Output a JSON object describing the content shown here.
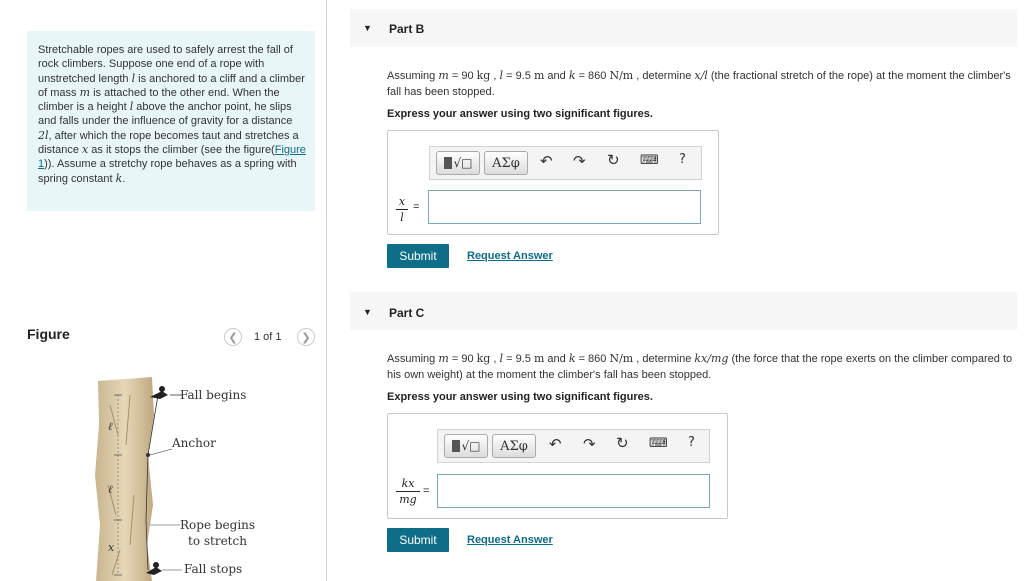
{
  "problem": {
    "text_parts": [
      "Stretchable ropes are used to safely arrest the fall of rock climbers. Suppose one end of a rope with unstretched length ",
      "l",
      " is anchored to a cliff and a climber of mass ",
      "m",
      " is attached to the other end. When the climber is a height ",
      "l",
      " above the anchor point, he slips and falls under the influence of gravity for a distance ",
      "2l",
      ", after which the rope becomes taut and stretches a distance ",
      "x",
      " as it stops the climber (see the figure(",
      "Figure 1",
      ")). Assume a stretchy rope behaves as a spring with spring constant ",
      "k",
      "."
    ]
  },
  "figure": {
    "label": "Figure",
    "pager": "1 of 1",
    "prev_icon": "chevron-left-icon",
    "next_icon": "chevron-right-icon",
    "annotations": [
      "Fall begins",
      "Anchor",
      "Rope begins",
      "to stretch",
      "Fall stops"
    ],
    "side_labels": [
      "ℓ",
      "ℓ",
      "x"
    ]
  },
  "parts": [
    {
      "title": "Part B",
      "q_parts": [
        "Assuming ",
        "m",
        " = 90 ",
        "kg",
        " , ",
        "l",
        " = 9.5 ",
        "m",
        " and ",
        "k",
        " = 860 ",
        "N/m",
        " , determine ",
        "x/l",
        " (the fractional stretch of the rope) at the moment the climber's fall has been stopped."
      ],
      "instruction": "Express your answer using two significant figures.",
      "frac_num": "x",
      "frac_den": "l",
      "equals": "=",
      "submit": "Submit",
      "request": "Request Answer"
    },
    {
      "title": "Part C",
      "q_parts": [
        "Assuming ",
        "m",
        " = 90 ",
        "kg",
        " , ",
        "l",
        " = 9.5 ",
        "m",
        " and ",
        "k",
        " = 860 ",
        "N/m",
        " , determine ",
        "kx/mg",
        " (the force that the rope exerts on the climber compared to his own weight) at the moment the climber's fall has been stopped."
      ],
      "instruction": "Express your answer using two significant figures.",
      "frac_num": "kx",
      "frac_den": "mg",
      "equals": "=",
      "submit": "Submit",
      "request": "Request Answer"
    }
  ],
  "toolbar": {
    "greek": "ΑΣφ",
    "icons": [
      "template-icon",
      "undo-icon",
      "redo-icon",
      "reset-icon",
      "keyboard-icon",
      "help-icon"
    ],
    "help": "?"
  },
  "colors": {
    "accent": "#0e6d87",
    "problem_bg": "#e8f6f8"
  }
}
